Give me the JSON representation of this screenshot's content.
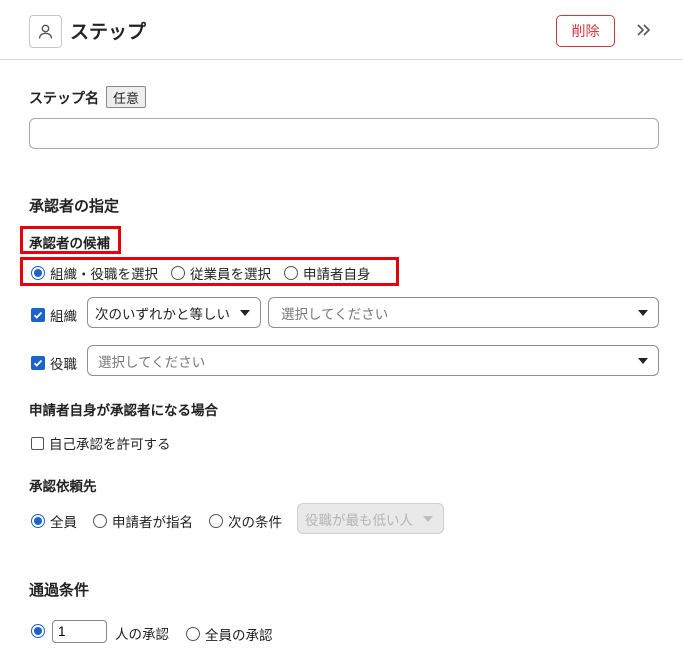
{
  "header": {
    "title": "ステップ",
    "delete_label": "削除"
  },
  "step_name": {
    "label": "ステップ名",
    "badge": "任意",
    "value": ""
  },
  "approver": {
    "section_title": "承認者の指定",
    "candidates_label": "承認者の候補",
    "candidate_options": [
      "組織・役職を選択",
      "従業員を選択",
      "申請者自身"
    ],
    "candidate_selected": "組織・役職を選択",
    "organization": {
      "label": "組織",
      "checked": true,
      "condition": "次のいずれかと等しい",
      "placeholder": "選択してください"
    },
    "position": {
      "label": "役職",
      "checked": true,
      "placeholder": "選択してください"
    }
  },
  "self_approval": {
    "heading": "申請者自身が承認者になる場合",
    "checkbox_label": "自己承認を許可する",
    "checked": false
  },
  "request_target": {
    "heading": "承認依頼先",
    "options": [
      "全員",
      "申請者が指名",
      "次の条件"
    ],
    "selected": "全員",
    "condition_select": "役職が最も低い人"
  },
  "pass_condition": {
    "heading": "通過条件",
    "count_value": "1",
    "count_suffix": "人の承認",
    "all_label": "全員の承認",
    "selected": "count"
  },
  "colors": {
    "accent": "#1a63c9",
    "danger": "#d0353b",
    "highlight": "#e5000b"
  }
}
